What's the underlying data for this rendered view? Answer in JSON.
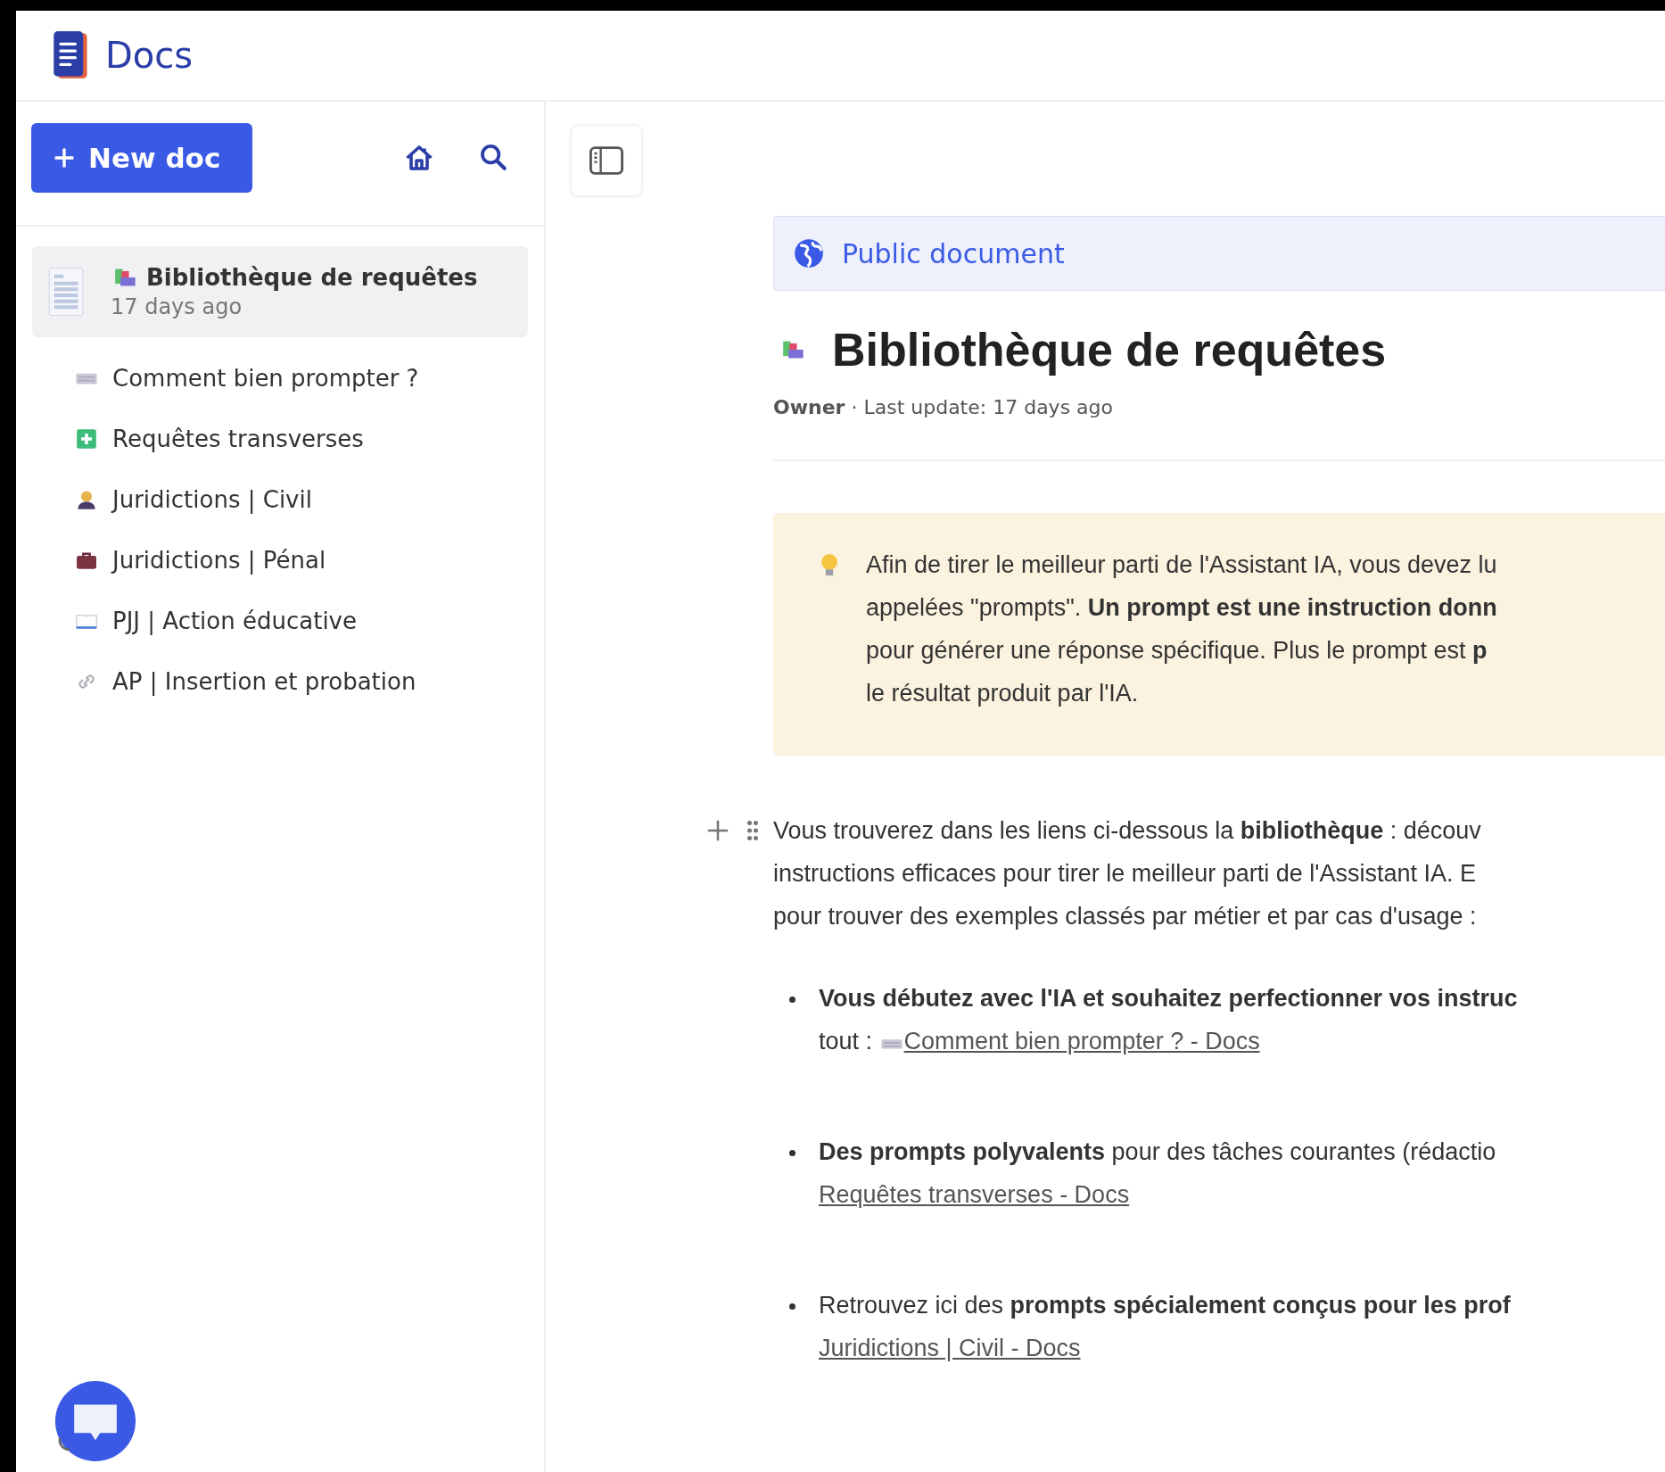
{
  "app": {
    "name": "Docs"
  },
  "sidebar": {
    "new_doc_button": "New doc",
    "current_doc": {
      "title": "Bibliothèque de requêtes",
      "updated": "17 days ago",
      "selected": true
    },
    "items": [
      {
        "title": "Comment bien prompter ?",
        "kind": "keyboard",
        "selected": false
      },
      {
        "title": "Requêtes transverses",
        "kind": "plus",
        "selected": false
      },
      {
        "title": "Juridictions | Civil",
        "kind": "person",
        "selected": false
      },
      {
        "title": "Juridictions | Pénal",
        "kind": "briefcase",
        "selected": false
      },
      {
        "title": "PJJ | Action éducative",
        "kind": "book",
        "selected": false
      },
      {
        "title": "AP | Insertion et probation",
        "kind": "link",
        "selected": false
      }
    ]
  },
  "document": {
    "visibility": "Public document",
    "title": "Bibliothèque de requêtes",
    "meta": "**Owner** · Last update: 17 days ago",
    "callout": {
      "lines": [
        "Afin de tirer le meilleur parti de l'Assistant IA, vous devez lu",
        "appelées \"prompts\". **Un prompt est une instruction donn**",
        "pour générer une réponse spécifique. Plus le prompt est **p**",
        "le résultat produit par l'IA."
      ]
    },
    "intro": {
      "lines": [
        "Vous trouverez dans les liens ci-dessous la **bibliothèque** : découv",
        "instructions efficaces pour tirer le meilleur parti de l'Assistant IA.  E",
        "pour trouver des exemples classés par métier et par cas d'usage :"
      ]
    },
    "bullets": [
      {
        "lines": [
          "**Vous débutez avec l'IA et souhaitez perfectionner vos instruc**"
        ],
        "link_prefix": "tout : ",
        "link": "Comment bien prompter ? - Docs",
        "kind": "keyboard"
      },
      {
        "lines": [
          "**Des prompts polyvalents** pour des tâches courantes (rédactio"
        ],
        "link": "Requêtes transverses - Docs",
        "kind": "plain"
      },
      {
        "lines": [
          "Retrouvez ici des **prompts spécialement conçus pour les prof**"
        ],
        "link": "Juridictions | Civil - Docs",
        "kind": "plain"
      }
    ]
  }
}
